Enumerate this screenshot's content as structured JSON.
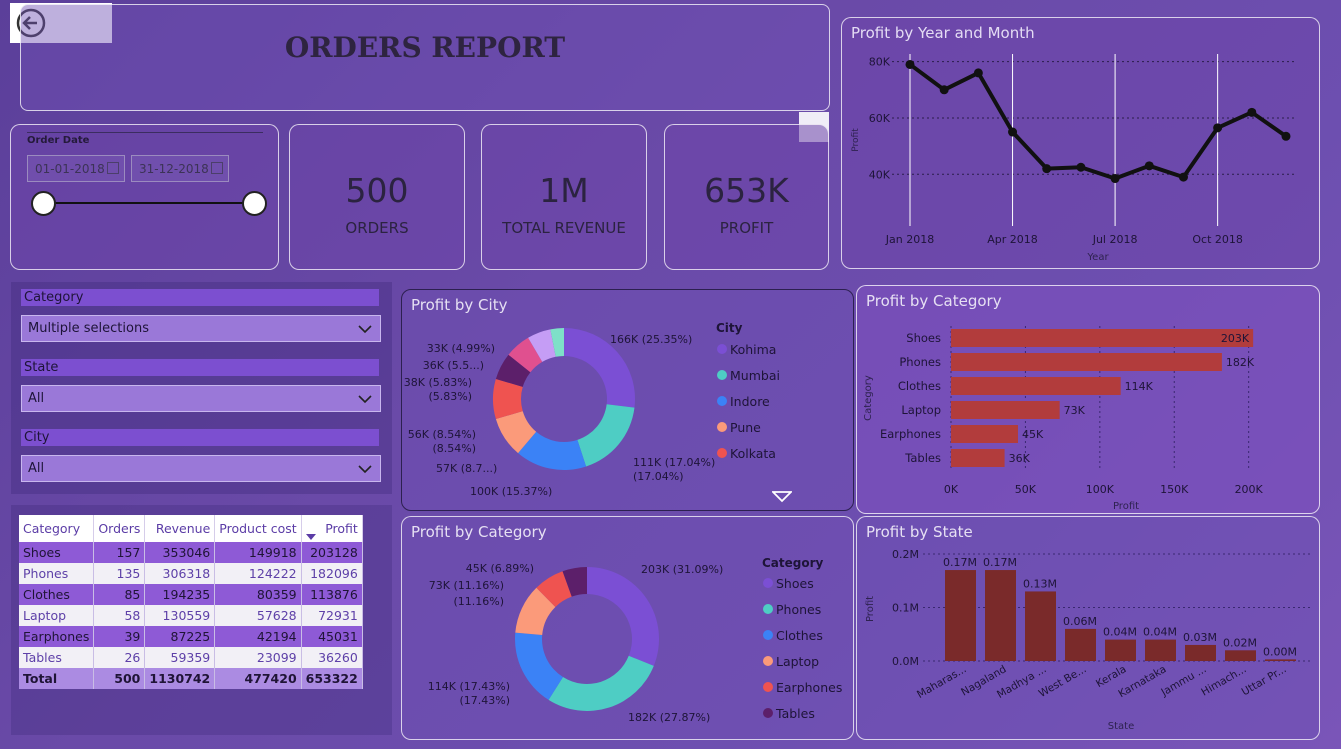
{
  "report": {
    "title": "ORDERS REPORT"
  },
  "date_filter": {
    "label": "Order Date",
    "start": "01-01-2018",
    "end": "31-12-2018"
  },
  "kpis": [
    {
      "value": "500",
      "label": "ORDERS"
    },
    {
      "value": "1M",
      "label": "TOTAL REVENUE"
    },
    {
      "value": "653K",
      "label": "PROFIT"
    }
  ],
  "slicers": [
    {
      "label": "Category",
      "value": "Multiple selections"
    },
    {
      "label": "State",
      "value": "All"
    },
    {
      "label": "City",
      "value": "All"
    }
  ],
  "table": {
    "columns": [
      "Category",
      "Orders",
      "Revenue",
      "Product cost",
      "Profit"
    ],
    "rows": [
      [
        "Shoes",
        "157",
        "353046",
        "149918",
        "203128"
      ],
      [
        "Phones",
        "135",
        "306318",
        "124222",
        "182096"
      ],
      [
        "Clothes",
        "85",
        "194235",
        "80359",
        "113876"
      ],
      [
        "Laptop",
        "58",
        "130559",
        "57628",
        "72931"
      ],
      [
        "Earphones",
        "39",
        "87225",
        "42194",
        "45031"
      ],
      [
        "Tables",
        "26",
        "59359",
        "23099",
        "36260"
      ]
    ],
    "total": [
      "Total",
      "500",
      "1130742",
      "477420",
      "653322"
    ]
  },
  "colors": {
    "kohima": "#7b4fd4",
    "mumbai": "#4ecdc4",
    "indore": "#3b82f6",
    "pune": "#fb9a7a",
    "kolkata": "#ef5350",
    "c6": "#5c1f6a",
    "c7": "#e0508f",
    "c8": "#c59df5",
    "c9": "#7ee0c8",
    "bar_cat": "#b23c3c",
    "bar_state": "#7a2a2a",
    "line": "#111111"
  },
  "chart_data": [
    {
      "id": "profit-year-month",
      "type": "line",
      "title": "Profit by Year and Month",
      "xlabel": "Year",
      "ylabel": "Profit",
      "x": [
        "Jan 2018",
        "Feb 2018",
        "Mar 2018",
        "Apr 2018",
        "May 2018",
        "Jun 2018",
        "Jul 2018",
        "Aug 2018",
        "Sep 2018",
        "Oct 2018",
        "Nov 2018",
        "Dec 2018"
      ],
      "x_tick_labels": [
        "Jan 2018",
        "Apr 2018",
        "Jul 2018",
        "Oct 2018"
      ],
      "values": [
        79000,
        70000,
        76000,
        55000,
        42000,
        42500,
        38500,
        43000,
        39000,
        56500,
        62000,
        53500
      ],
      "y_ticks": [
        "40K",
        "60K",
        "80K"
      ],
      "ylim": [
        33000,
        82000
      ]
    },
    {
      "id": "profit-by-city",
      "type": "pie",
      "title": "Profit by City",
      "legend_title": "City",
      "legend": [
        "Kohima",
        "Mumbai",
        "Indore",
        "Pune",
        "Kolkata"
      ],
      "values": [
        166,
        111,
        100,
        57,
        56,
        38,
        36,
        33,
        19
      ],
      "labels": [
        "166K (25.35%)",
        "111K (17.04%)",
        "100K (15.37%)",
        "57K (8.7...)",
        "56K (8.54%)",
        "38K (5.83%)",
        "36K (5.5...)",
        "33K (4.99%)",
        ""
      ]
    },
    {
      "id": "profit-by-category-bar",
      "type": "bar",
      "title": "Profit by Category",
      "categories": [
        "Shoes",
        "Phones",
        "Clothes",
        "Laptop",
        "Earphones",
        "Tables"
      ],
      "values": [
        203,
        182,
        114,
        73,
        45,
        36
      ],
      "value_labels": [
        "203K",
        "182K",
        "114K",
        "73K",
        "45K",
        "36K"
      ],
      "x_ticks": [
        "0K",
        "50K",
        "100K",
        "150K",
        "200K"
      ],
      "xlabel": "Profit",
      "ylabel": "Category",
      "xlim": [
        0,
        215
      ]
    },
    {
      "id": "profit-by-category-donut",
      "type": "pie",
      "title": "Profit by Category",
      "legend_title": "Category",
      "legend": [
        "Shoes",
        "Phones",
        "Clothes",
        "Laptop",
        "Earphones",
        "Tables"
      ],
      "values": [
        203,
        182,
        114,
        73,
        45,
        36
      ],
      "labels": [
        "203K (31.09%)",
        "182K (27.87%)",
        "114K (17.43%)",
        "73K (11.16%)",
        "45K (6.89%)",
        ""
      ]
    },
    {
      "id": "profit-by-state",
      "type": "bar",
      "title": "Profit by State",
      "categories": [
        "Maharas...",
        "Nagaland",
        "Madhya ...",
        "West Be...",
        "Kerala",
        "Karnataka",
        "Jammu ...",
        "Himach...",
        "Uttar Pr..."
      ],
      "values": [
        0.17,
        0.17,
        0.13,
        0.06,
        0.04,
        0.04,
        0.03,
        0.02,
        0.003
      ],
      "value_labels": [
        "0.17M",
        "0.17M",
        "0.13M",
        "0.06M",
        "0.04M",
        "0.04M",
        "0.03M",
        "0.02M",
        "0.00M"
      ],
      "y_ticks": [
        "0.0M",
        "0.1M",
        "0.2M"
      ],
      "xlabel": "State",
      "ylabel": "Profit",
      "ylim": [
        0,
        0.2
      ]
    }
  ]
}
